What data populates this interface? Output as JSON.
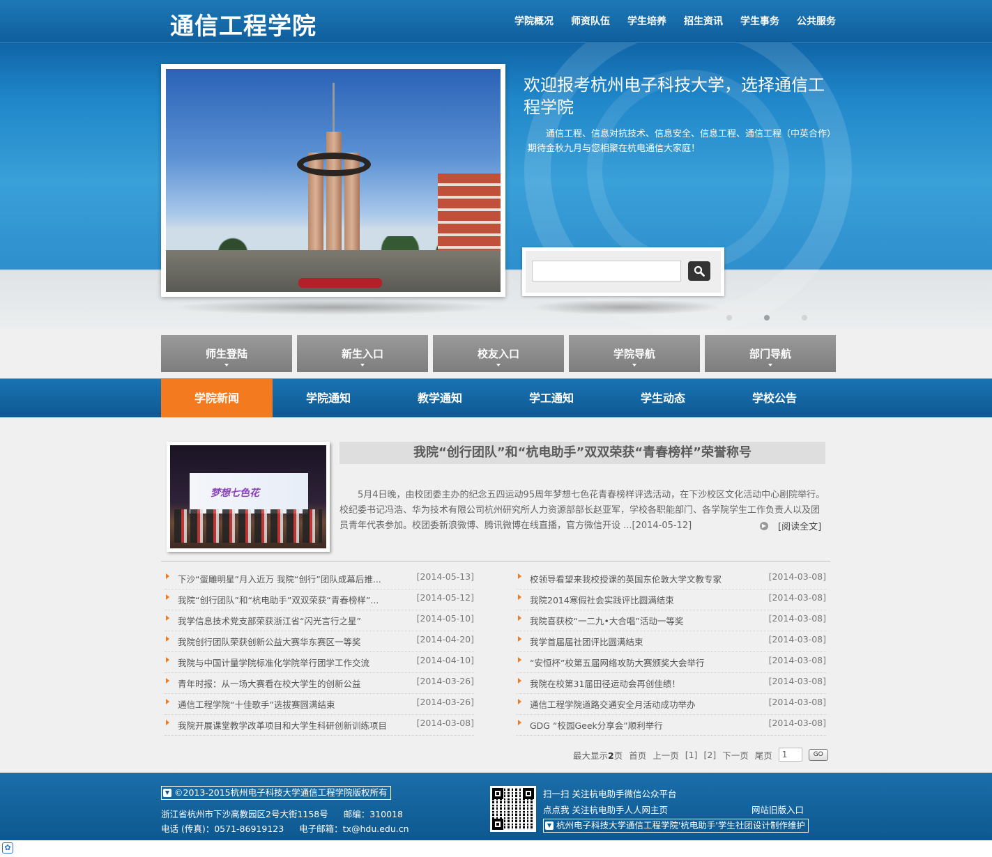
{
  "site": {
    "title": "通信工程学院"
  },
  "topnav": [
    "学院概况",
    "师资队伍",
    "学生培养",
    "招生资讯",
    "学生事务",
    "公共服务"
  ],
  "hero": {
    "heading": "欢迎报考杭州电子科技大学，选择通信工程学院",
    "description": "通信工程、信息对抗技术、信息安全、信息工程、通信工程（中英合作）期待金秋九月与您相聚在杭电通信大家庭！",
    "search_placeholder": "",
    "slides_total": 3,
    "slide_active": 2
  },
  "quick_links": [
    "师生登陆",
    "新生入口",
    "校友入口",
    "学院导航",
    "部门导航"
  ],
  "tabs": [
    "学院新闻",
    "学院通知",
    "教学通知",
    "学工通知",
    "学生动态",
    "学校公告"
  ],
  "featured": {
    "image_text": "梦想七色花",
    "title": "我院“创行团队”和“杭电助手”双双荣获“青春榜样”荣誉称号",
    "body": "5月4日晚，由校团委主办的纪念五四运动95周年梦想七色花青春榜样评选活动，在下沙校区文化活动中心剧院举行。校纪委书记冯浩、华为技术有限公司杭州研究所人力资源部部长赵亚军，学校各职能部门、各学院学生工作负责人以及团员青年代表参加。校团委新浪微博、腾讯微博在线直播，官方微信开设 ...[2014-05-12]",
    "read_more": "[阅读全文]"
  },
  "news_left": [
    {
      "title": "下沙“蛋雕明星”月入近万 我院“创行”团队成幕后推...",
      "date": "[2014-05-13]"
    },
    {
      "title": "我院“创行团队”和“杭电助手”双双荣获“青春榜样”...",
      "date": "[2014-05-12]"
    },
    {
      "title": "我学信息技术党支部荣获浙江省“闪光言行之星”",
      "date": "[2014-05-10]"
    },
    {
      "title": "我院创行团队荣获创新公益大赛华东赛区一等奖",
      "date": "[2014-04-20]"
    },
    {
      "title": "我院与中国计量学院标准化学院举行团学工作交流",
      "date": "[2014-04-10]"
    },
    {
      "title": "青年时报：从一场大赛看在校大学生的创新公益",
      "date": "[2014-03-26]"
    },
    {
      "title": "通信工程学院“十佳歌手”选拔赛圆满结束",
      "date": "[2014-03-26]"
    },
    {
      "title": "我院开展课堂教学改革项目和大学生科研创新训练项目",
      "date": "[2014-03-08]"
    }
  ],
  "news_right": [
    {
      "title": "校领导看望来我校授课的英国东伦敦大学文教专家",
      "date": "[2014-03-08]"
    },
    {
      "title": "我院2014寒假社会实践评比圆满结束",
      "date": "[2014-03-08]"
    },
    {
      "title": "我院喜获校“一二九•大合唱”活动一等奖",
      "date": "[2014-03-08]"
    },
    {
      "title": "我学首届届社团评比圆满结束",
      "date": "[2014-03-08]"
    },
    {
      "title": "“安恒杯”校第五届网络攻防大赛颁奖大会举行",
      "date": "[2014-03-08]"
    },
    {
      "title": "我院在校第31届田径运动会再创佳绩！",
      "date": "[2014-03-08]"
    },
    {
      "title": "通信工程学院道路交通安全月活动成功举办",
      "date": "[2014-03-08]"
    },
    {
      "title": "GDG “校园Geek分享会”顺利举行",
      "date": "[2014-03-08]"
    }
  ],
  "pager": {
    "max_label": "最大显示",
    "max_pages": "2",
    "pages_unit": "页",
    "first": "首页",
    "prev": "上一页",
    "page1": "[1]",
    "page2": "[2]",
    "next": "下一页",
    "last": "尾页",
    "input_value": "1",
    "go": "GO"
  },
  "footer": {
    "copyright": "©2013-2015杭州电子科技大学通信工程学院版权所有",
    "address": "浙江省杭州市下沙高教园区2号大街1158号",
    "postcode": "邮编：310018",
    "phone": "电话 (传真)：0571-86919123",
    "email": "电子邮箱：tx@hdu.edu.cn",
    "wechat_line": "扫一扫 关注杭电助手微信公众平台",
    "renren_line": "点点我 关注杭电助手人人网主页",
    "old_site": "网站旧版入口",
    "maintainer": "杭州电子科技大学通信工程学院'杭电助手'学生社团设计制作维护"
  }
}
